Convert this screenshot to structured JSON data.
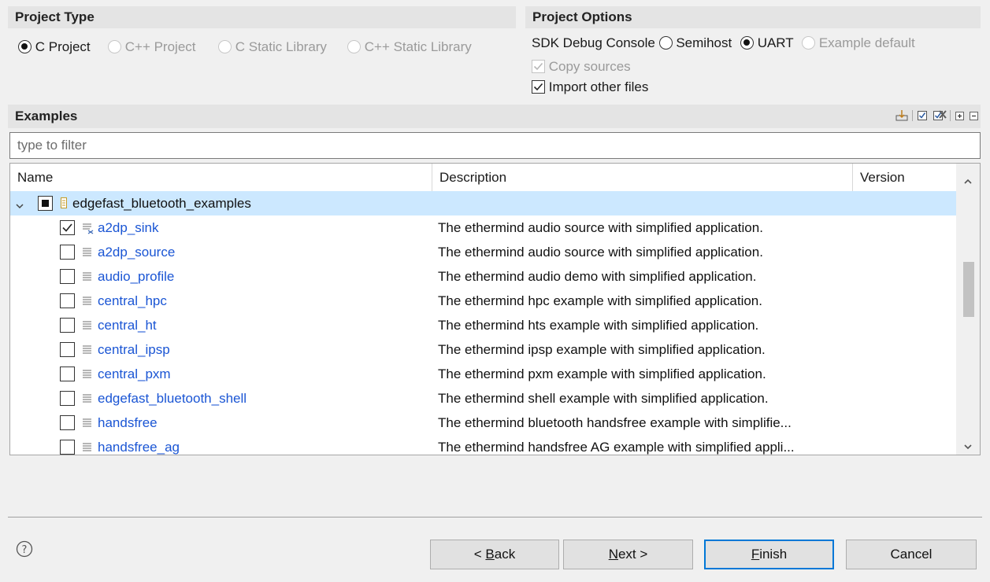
{
  "project_type": {
    "title": "Project Type",
    "options": [
      {
        "label": "C Project",
        "selected": true,
        "enabled": true
      },
      {
        "label": "C++ Project",
        "selected": false,
        "enabled": false
      },
      {
        "label": "C Static Library",
        "selected": false,
        "enabled": false
      },
      {
        "label": "C++ Static Library",
        "selected": false,
        "enabled": false
      }
    ]
  },
  "project_options": {
    "title": "Project Options",
    "sdk_console_label": "SDK Debug Console",
    "console_options": [
      {
        "label": "Semihost",
        "selected": false,
        "enabled": true
      },
      {
        "label": "UART",
        "selected": true,
        "enabled": true
      },
      {
        "label": "Example default",
        "selected": false,
        "enabled": false
      }
    ],
    "copy_sources": {
      "label": "Copy sources",
      "checked": true,
      "enabled": false
    },
    "import_other_files": {
      "label": "Import other files",
      "checked": true,
      "enabled": true
    }
  },
  "examples": {
    "title": "Examples",
    "toolbar_icons": [
      "import-icon",
      "check-all-icon",
      "uncheck-all-icon",
      "expand-all-icon",
      "collapse-all-icon"
    ],
    "filter_placeholder": "type to filter",
    "columns": {
      "name": "Name",
      "description": "Description",
      "version": "Version"
    },
    "group": {
      "name": "edgefast_bluetooth_examples",
      "state": "partial",
      "expanded": true
    },
    "rows": [
      {
        "name": "a2dp_sink",
        "description": "The ethermind audio source with simplified application.",
        "checked": true
      },
      {
        "name": "a2dp_source",
        "description": "The ethermind audio source with simplified application.",
        "checked": false
      },
      {
        "name": "audio_profile",
        "description": "The ethermind audio demo with simplified application.",
        "checked": false
      },
      {
        "name": "central_hpc",
        "description": "The ethermind hpc example with simplified application.",
        "checked": false
      },
      {
        "name": "central_ht",
        "description": "The ethermind hts example with simplified application.",
        "checked": false
      },
      {
        "name": "central_ipsp",
        "description": "The ethermind ipsp example with simplified application.",
        "checked": false
      },
      {
        "name": "central_pxm",
        "description": "The ethermind pxm example with simplified application.",
        "checked": false
      },
      {
        "name": "edgefast_bluetooth_shell",
        "description": "The ethermind shell example with simplified application.",
        "checked": false
      },
      {
        "name": "handsfree",
        "description": "The ethermind bluetooth handsfree example with simplifie...",
        "checked": false
      },
      {
        "name": "handsfree_ag",
        "description": "The ethermind handsfree AG example with simplified appli...",
        "checked": false
      }
    ]
  },
  "buttons": {
    "back": {
      "mnemonic": "B",
      "prefix": "< ",
      "rest": "ack"
    },
    "next": {
      "mnemonic": "N",
      "rest": "ext >"
    },
    "finish": {
      "mnemonic": "F",
      "rest": "inish"
    },
    "cancel": "Cancel"
  },
  "colors": {
    "link": "#1a55d4",
    "selection": "#cce8ff",
    "default_button_border": "#0078d7"
  }
}
